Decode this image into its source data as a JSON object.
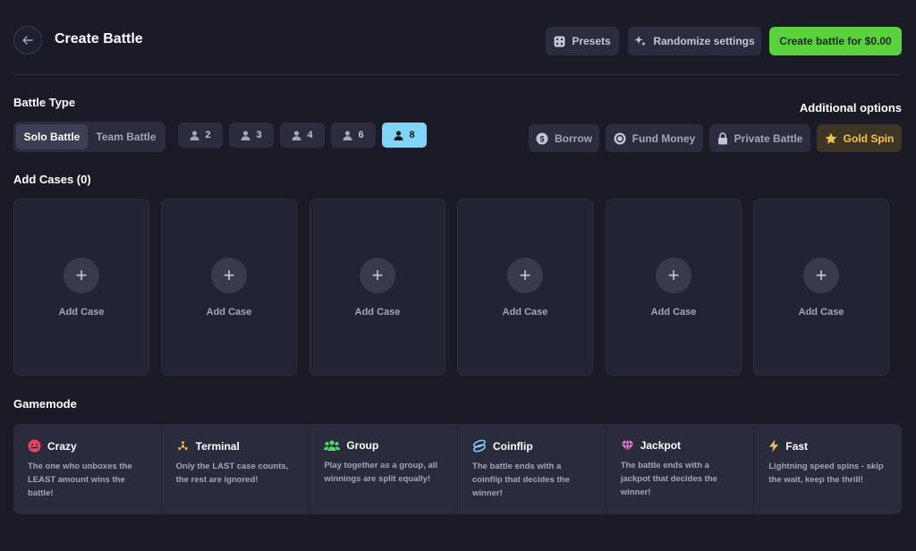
{
  "header": {
    "title": "Create Battle",
    "presets_label": "Presets",
    "randomize_label": "Randomize settings",
    "create_label": "Create battle for $0.00"
  },
  "battle_type": {
    "title": "Battle Type",
    "modes": [
      "Solo Battle",
      "Team Battle"
    ],
    "active_mode": "Solo Battle",
    "player_counts": [
      "2",
      "3",
      "4",
      "6",
      "8"
    ],
    "active_player_count": "8"
  },
  "additional_options": {
    "title": "Additional options",
    "items": [
      {
        "label": "Borrow",
        "icon": "dollar-coin-icon"
      },
      {
        "label": "Fund Money",
        "icon": "coins-icon"
      },
      {
        "label": "Private Battle",
        "icon": "lock-icon"
      },
      {
        "label": "Gold Spin",
        "icon": "star-icon"
      }
    ]
  },
  "cases": {
    "title": "Add Cases (0)",
    "slots": [
      {
        "label": "Add Case"
      },
      {
        "label": "Add Case"
      },
      {
        "label": "Add Case"
      },
      {
        "label": "Add Case"
      },
      {
        "label": "Add Case"
      },
      {
        "label": "Add Case"
      }
    ]
  },
  "gamemode": {
    "title": "Gamemode",
    "modes": [
      {
        "name": "Crazy",
        "description": "The one who unboxes the LEAST amount wins the battle!",
        "icon": "crazy-face-icon",
        "color": "#f0415f"
      },
      {
        "name": "Terminal",
        "description": "Only the LAST case counts, the rest are ignored!",
        "icon": "radiation-icon",
        "color": "#f5c543"
      },
      {
        "name": "Group",
        "description": "Play together as a group, all winnings are split equally!",
        "icon": "group-icon",
        "color": "#4cd964"
      },
      {
        "name": "Coinflip",
        "description": "The battle ends with a coinflip that decides the winner!",
        "icon": "coinflip-icon",
        "color": "#7fd5f6"
      },
      {
        "name": "Jackpot",
        "description": "The battle ends with a jackpot that decides the winner!",
        "icon": "diamond-icon",
        "color": "#f27ad6"
      },
      {
        "name": "Fast",
        "description": "Lightning speed spins - skip the wait, keep the thrill!",
        "icon": "lightning-icon",
        "color": "#f5c543"
      }
    ]
  },
  "colors": {
    "background": "#1a1b27",
    "panel": "#2b2d3e",
    "accent_green": "#5ad23a",
    "accent_cyan": "#7fd5f6",
    "gold": "#f5c543"
  }
}
